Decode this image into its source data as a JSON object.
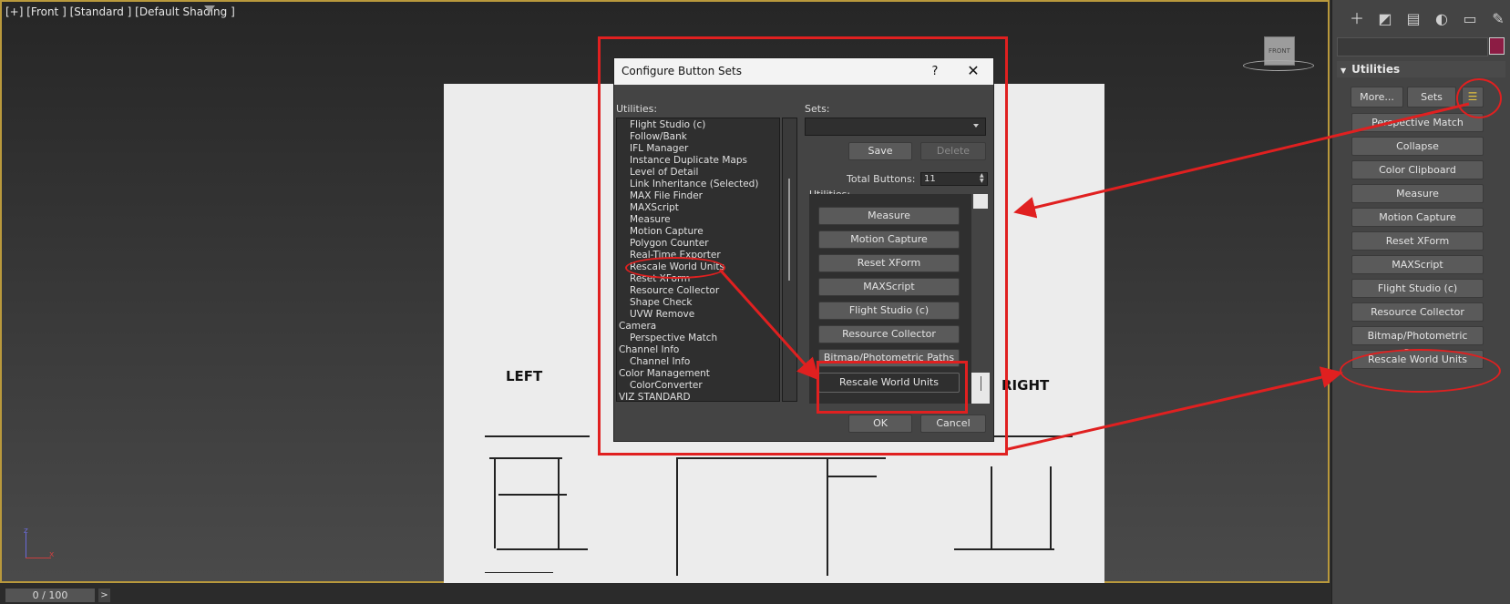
{
  "viewport": {
    "label": "[+] [Front ] [Standard ] [Default Shading ]",
    "viewcube_label": "FRONT",
    "blueprint": {
      "left_label": "LEFT",
      "right_label": "RIGHT"
    },
    "axis": {
      "z": "z",
      "x": "x"
    }
  },
  "timeline": {
    "frame_counter": "0 / 100",
    "next_label": ">"
  },
  "command_panel": {
    "rollout_title": "Utilities",
    "more_label": "More...",
    "sets_label": "Sets",
    "buttons": [
      "Perspective Match",
      "Collapse",
      "Color Clipboard",
      "Measure",
      "Motion Capture",
      "Reset XForm",
      "MAXScript",
      "Flight Studio (c)",
      "Resource Collector",
      "Bitmap/Photometric Paths",
      "Rescale World Units"
    ],
    "color_swatch": "#8c1c44"
  },
  "dialog": {
    "title": "Configure Button Sets",
    "help_label": "?",
    "close_label": "✕",
    "utilities_label": "Utilities:",
    "sets_label": "Sets:",
    "save_label": "Save",
    "delete_label": "Delete",
    "total_buttons_label": "Total Buttons:",
    "total_buttons_value": "11",
    "buttons_utilities_label": "Utilities:",
    "utility_list": [
      {
        "text": "Flight Studio (c)",
        "indent": true
      },
      {
        "text": "Follow/Bank",
        "indent": true
      },
      {
        "text": "IFL Manager",
        "indent": true
      },
      {
        "text": "Instance Duplicate Maps",
        "indent": true
      },
      {
        "text": "Level of Detail",
        "indent": true
      },
      {
        "text": "Link Inheritance (Selected)",
        "indent": true
      },
      {
        "text": "MAX File Finder",
        "indent": true
      },
      {
        "text": "MAXScript",
        "indent": true
      },
      {
        "text": "Measure",
        "indent": true
      },
      {
        "text": "Motion Capture",
        "indent": true
      },
      {
        "text": "Polygon Counter",
        "indent": true
      },
      {
        "text": "Real-Time Exporter",
        "indent": true
      },
      {
        "text": "Rescale World Units",
        "indent": true
      },
      {
        "text": "Reset XForm",
        "indent": true
      },
      {
        "text": "Resource Collector",
        "indent": true
      },
      {
        "text": "Shape Check",
        "indent": true
      },
      {
        "text": "UVW Remove",
        "indent": true
      },
      {
        "text": "Camera",
        "indent": false
      },
      {
        "text": "Perspective Match",
        "indent": true
      },
      {
        "text": "Channel Info",
        "indent": false
      },
      {
        "text": "Channel Info",
        "indent": true
      },
      {
        "text": "Color Management",
        "indent": false
      },
      {
        "text": "ColorConverter",
        "indent": true
      },
      {
        "text": "VIZ STANDARD",
        "indent": false
      }
    ],
    "set_buttons": [
      "Measure",
      "Motion Capture",
      "Reset XForm",
      "MAXScript",
      "Flight Studio (c)",
      "Resource Collector",
      "Bitmap/Photometric Paths"
    ],
    "selected_button": "Rescale World Units",
    "ok_label": "OK",
    "cancel_label": "Cancel"
  },
  "colors": {
    "annotation_red": "#e02020",
    "viewport_border": "#b9993c"
  }
}
